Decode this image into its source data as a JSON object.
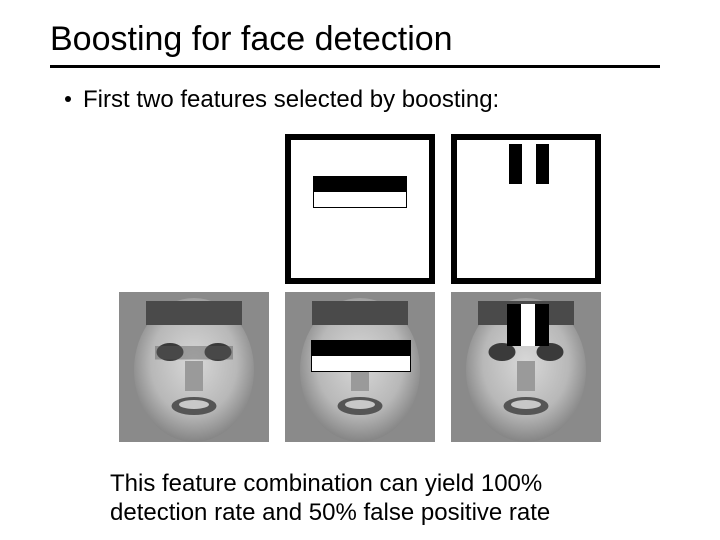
{
  "title": "Boosting for face detection",
  "bullet1": "First two features selected by boosting:",
  "caption": "This feature combination can yield 100% detection rate and 50% false positive rate",
  "features": {
    "haarA_desc": "horizontal two-rectangle (eyes region)",
    "haarB_desc": "vertical three-rectangle (nose bridge region)"
  }
}
